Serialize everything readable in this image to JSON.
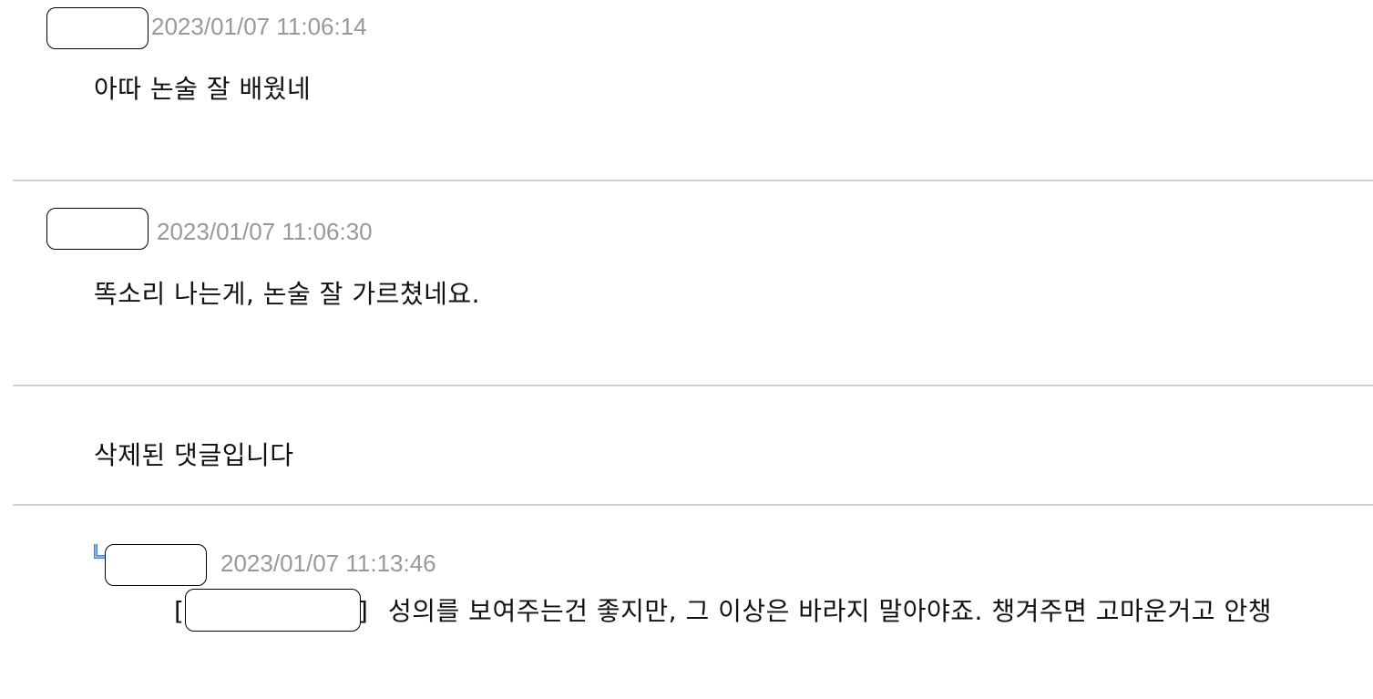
{
  "comments": [
    {
      "timestamp": "2023/01/07 11:06:14",
      "text": "아따 논술 잘 배웠네"
    },
    {
      "timestamp": "2023/01/07 11:06:30",
      "text": "똑소리 나는게, 논술 잘 가르쳤네요."
    },
    {
      "text": "삭제된 댓글입니다"
    },
    {
      "timestamp": "2023/01/07 11:13:46",
      "bracket_open": "[",
      "bracket_close": "]",
      "text": "성의를 보여주는건 좋지만, 그 이상은 바라지 말아야죠. 챙겨주면 고마운거고 안챙",
      "is_reply": true
    }
  ],
  "icons": {
    "reply": "reply-arrow-icon"
  },
  "colors": {
    "timestamp": "#999999",
    "divider": "#d2d2d2",
    "reply_icon": "#4a7fd0"
  }
}
